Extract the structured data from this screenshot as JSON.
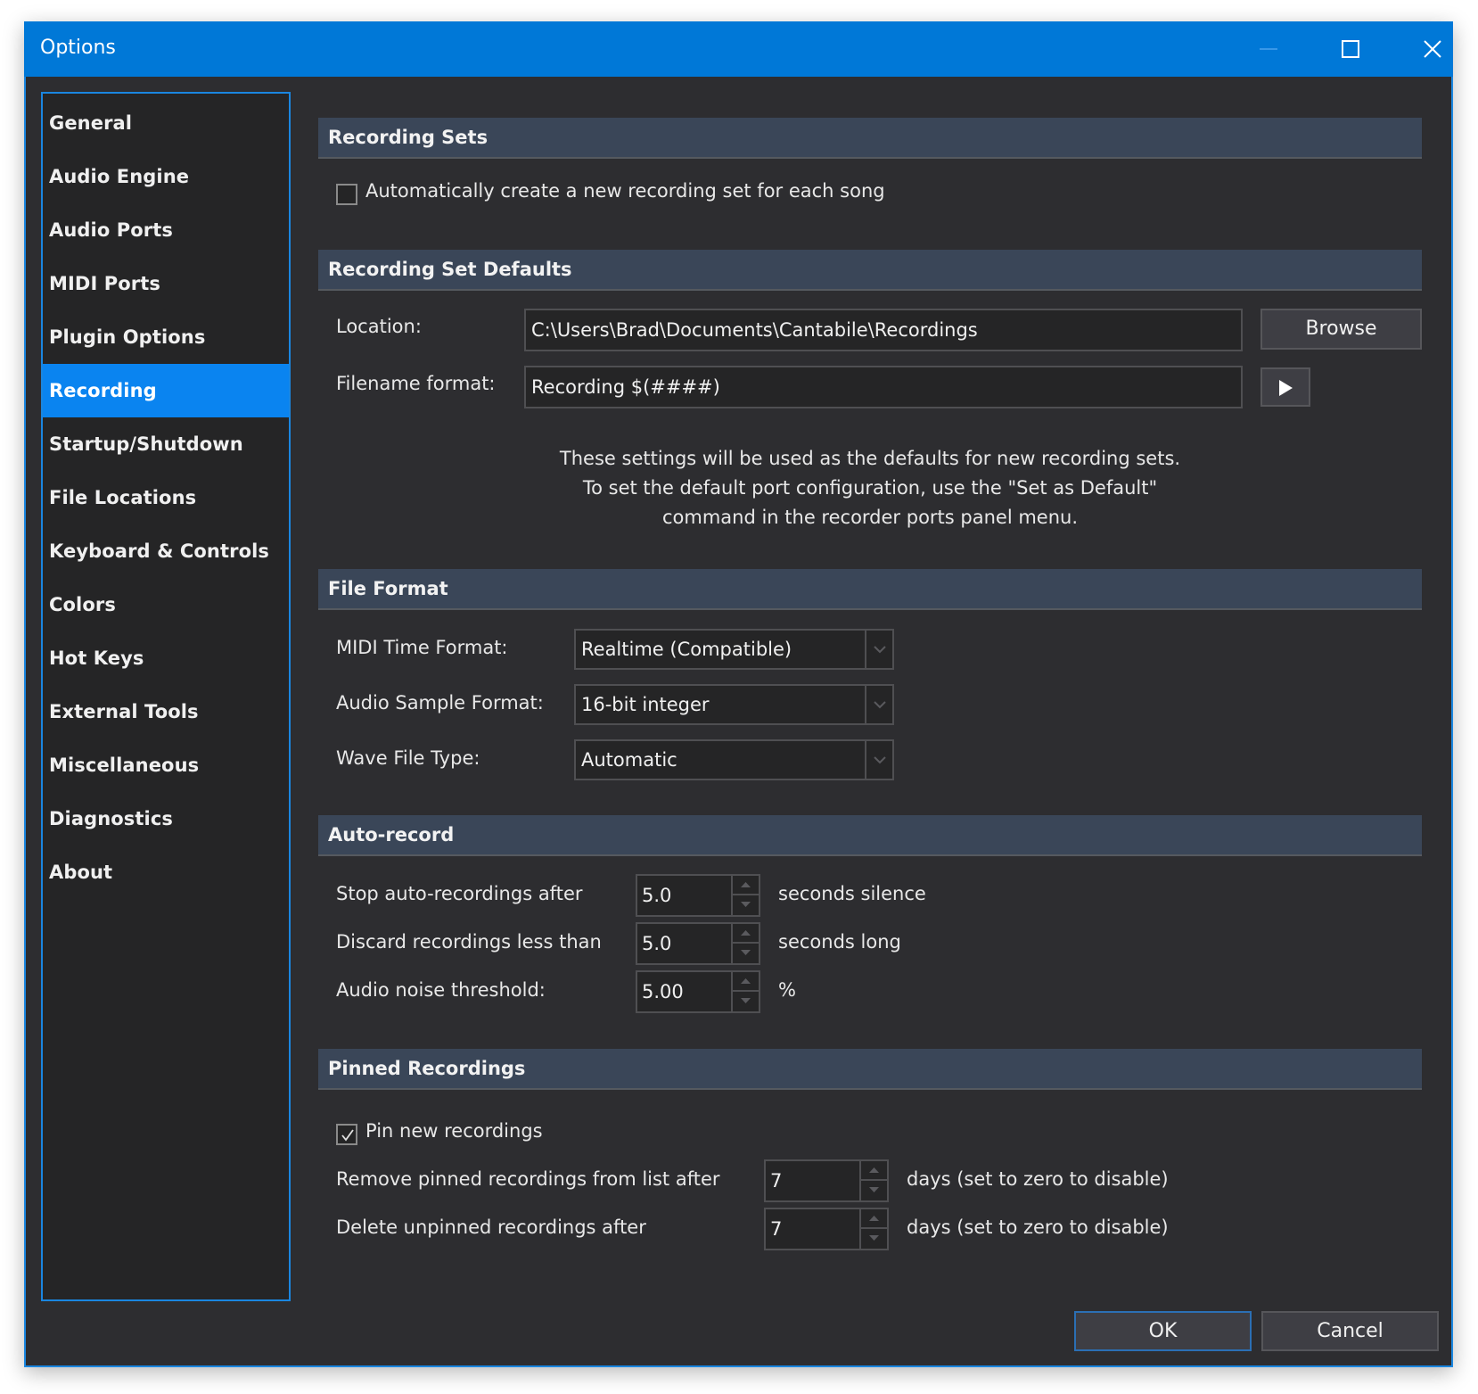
{
  "window": {
    "title": "Options",
    "controls": {
      "minimize": "minimize",
      "maximize": "maximize",
      "close": "close"
    }
  },
  "colors": {
    "titlebar": "#0078d7",
    "accent": "#0a84f0",
    "background": "#2d2d30",
    "section_header": "#3a4658"
  },
  "sidebar": {
    "selected": "Recording",
    "items": [
      {
        "label": "General"
      },
      {
        "label": "Audio Engine"
      },
      {
        "label": "Audio Ports"
      },
      {
        "label": "MIDI Ports"
      },
      {
        "label": "Plugin Options"
      },
      {
        "label": "Recording"
      },
      {
        "label": "Startup/Shutdown"
      },
      {
        "label": "File Locations"
      },
      {
        "label": "Keyboard & Controls"
      },
      {
        "label": "Colors"
      },
      {
        "label": "Hot Keys"
      },
      {
        "label": "External Tools"
      },
      {
        "label": "Miscellaneous"
      },
      {
        "label": "Diagnostics"
      },
      {
        "label": "About"
      }
    ]
  },
  "recording_sets": {
    "header": "Recording Sets",
    "auto_create": {
      "label": "Automatically create a new recording set for each song",
      "checked": false
    }
  },
  "recording_set_defaults": {
    "header": "Recording Set Defaults",
    "location_label": "Location:",
    "location_value": "C:\\Users\\Brad\\Documents\\Cantabile\\Recordings",
    "browse_label": "Browse",
    "filename_label": "Filename format:",
    "filename_value": "Recording $(####)",
    "filename_menu_icon": "play-icon",
    "info_lines": [
      "These settings will be used as the defaults for new recording sets.",
      "To set the default port configuration, use the \"Set as Default\"",
      "command in the recorder ports panel menu."
    ]
  },
  "file_format": {
    "header": "File Format",
    "midi_time_label": "MIDI Time Format:",
    "midi_time_value": "Realtime (Compatible)",
    "audio_sample_label": "Audio Sample Format:",
    "audio_sample_value": "16-bit integer",
    "wave_type_label": "Wave File Type:",
    "wave_type_value": "Automatic"
  },
  "auto_record": {
    "header": "Auto-record",
    "stop_label": "Stop auto-recordings after",
    "stop_value": "5.0",
    "stop_unit": "seconds silence",
    "discard_label": "Discard recordings less than",
    "discard_value": "5.0",
    "discard_unit": "seconds long",
    "noise_label": "Audio noise threshold:",
    "noise_value": "5.00",
    "noise_unit": "%"
  },
  "pinned_recordings": {
    "header": "Pinned Recordings",
    "pin_new": {
      "label": "Pin new recordings",
      "checked": true
    },
    "remove_label": "Remove pinned recordings from list after",
    "remove_value": "7",
    "remove_unit": "days (set to zero to disable)",
    "delete_label": "Delete unpinned recordings after",
    "delete_value": "7",
    "delete_unit": "days (set to zero to disable)"
  },
  "footer": {
    "ok_label": "OK",
    "cancel_label": "Cancel"
  }
}
